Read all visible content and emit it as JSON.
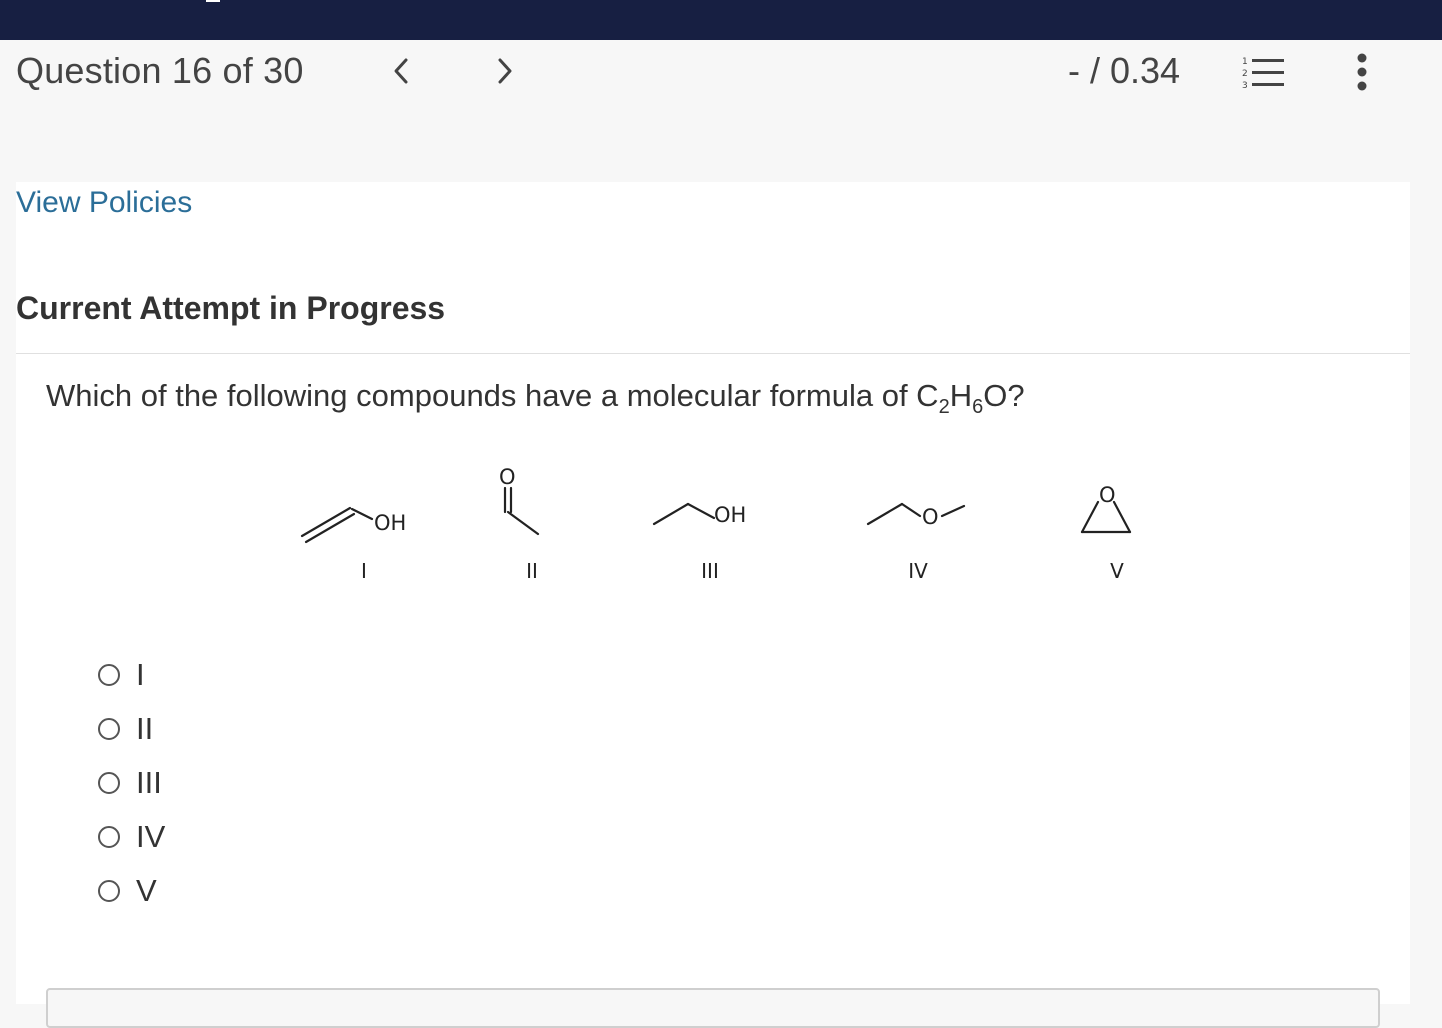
{
  "header": {
    "question_label": "Question 16 of 30",
    "score": "- / 0.34"
  },
  "card": {
    "policies_link": "View Policies",
    "attempt_heading": "Current Attempt in Progress"
  },
  "question": {
    "text_before": "Which of the following compounds have a molecular formula of C",
    "sub1": "2",
    "text_mid": "H",
    "sub2": "6",
    "text_after": "O?"
  },
  "structures": [
    {
      "numeral": "I",
      "atom_label": "OH"
    },
    {
      "numeral": "II",
      "atom_label": "O"
    },
    {
      "numeral": "III",
      "atom_label": "OH"
    },
    {
      "numeral": "IV",
      "atom_label": "O"
    },
    {
      "numeral": "V",
      "atom_label": "O"
    }
  ],
  "choices": [
    "I",
    "II",
    "III",
    "IV",
    "V"
  ],
  "icons": {
    "prev": "chevron-left-icon",
    "next": "chevron-right-icon",
    "list": "numbered-list-icon",
    "more": "more-vertical-icon"
  },
  "colors": {
    "topbar": "#171f42",
    "link": "#2b6e98",
    "text": "#333333",
    "page_bg": "#f7f7f7"
  }
}
